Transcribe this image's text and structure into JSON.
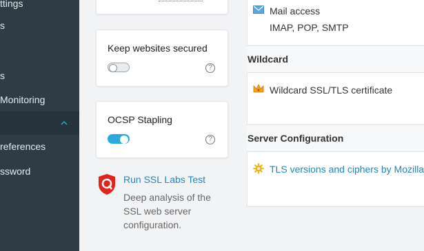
{
  "sidebar": {
    "items": [
      {
        "label": "ttings"
      },
      {
        "label": "s"
      },
      {
        "label": "s"
      },
      {
        "label": "Monitoring"
      },
      {
        "label": ""
      },
      {
        "label": "references"
      },
      {
        "label": "ssword"
      }
    ]
  },
  "cards": {
    "keep_secured": {
      "title": "Keep websites secured",
      "help": "?"
    },
    "ocsp": {
      "title": "OCSP Stapling",
      "help": "?"
    }
  },
  "ssl_labs": {
    "link": "Run SSL Labs Test",
    "description": "Deep analysis of the SSL web server configuration."
  },
  "right": {
    "mail": {
      "label": "Mail access",
      "sub": "IMAP, POP, SMTP"
    },
    "wildcard_heading": "Wildcard",
    "wildcard_item": "Wildcard SSL/TLS certificate",
    "server_heading": "Server Configuration",
    "tls_link": "TLS versions and ciphers by Mozilla"
  },
  "colors": {
    "sidebar": "#2f3c46",
    "accent": "#28aade",
    "link": "#1f86c2"
  }
}
